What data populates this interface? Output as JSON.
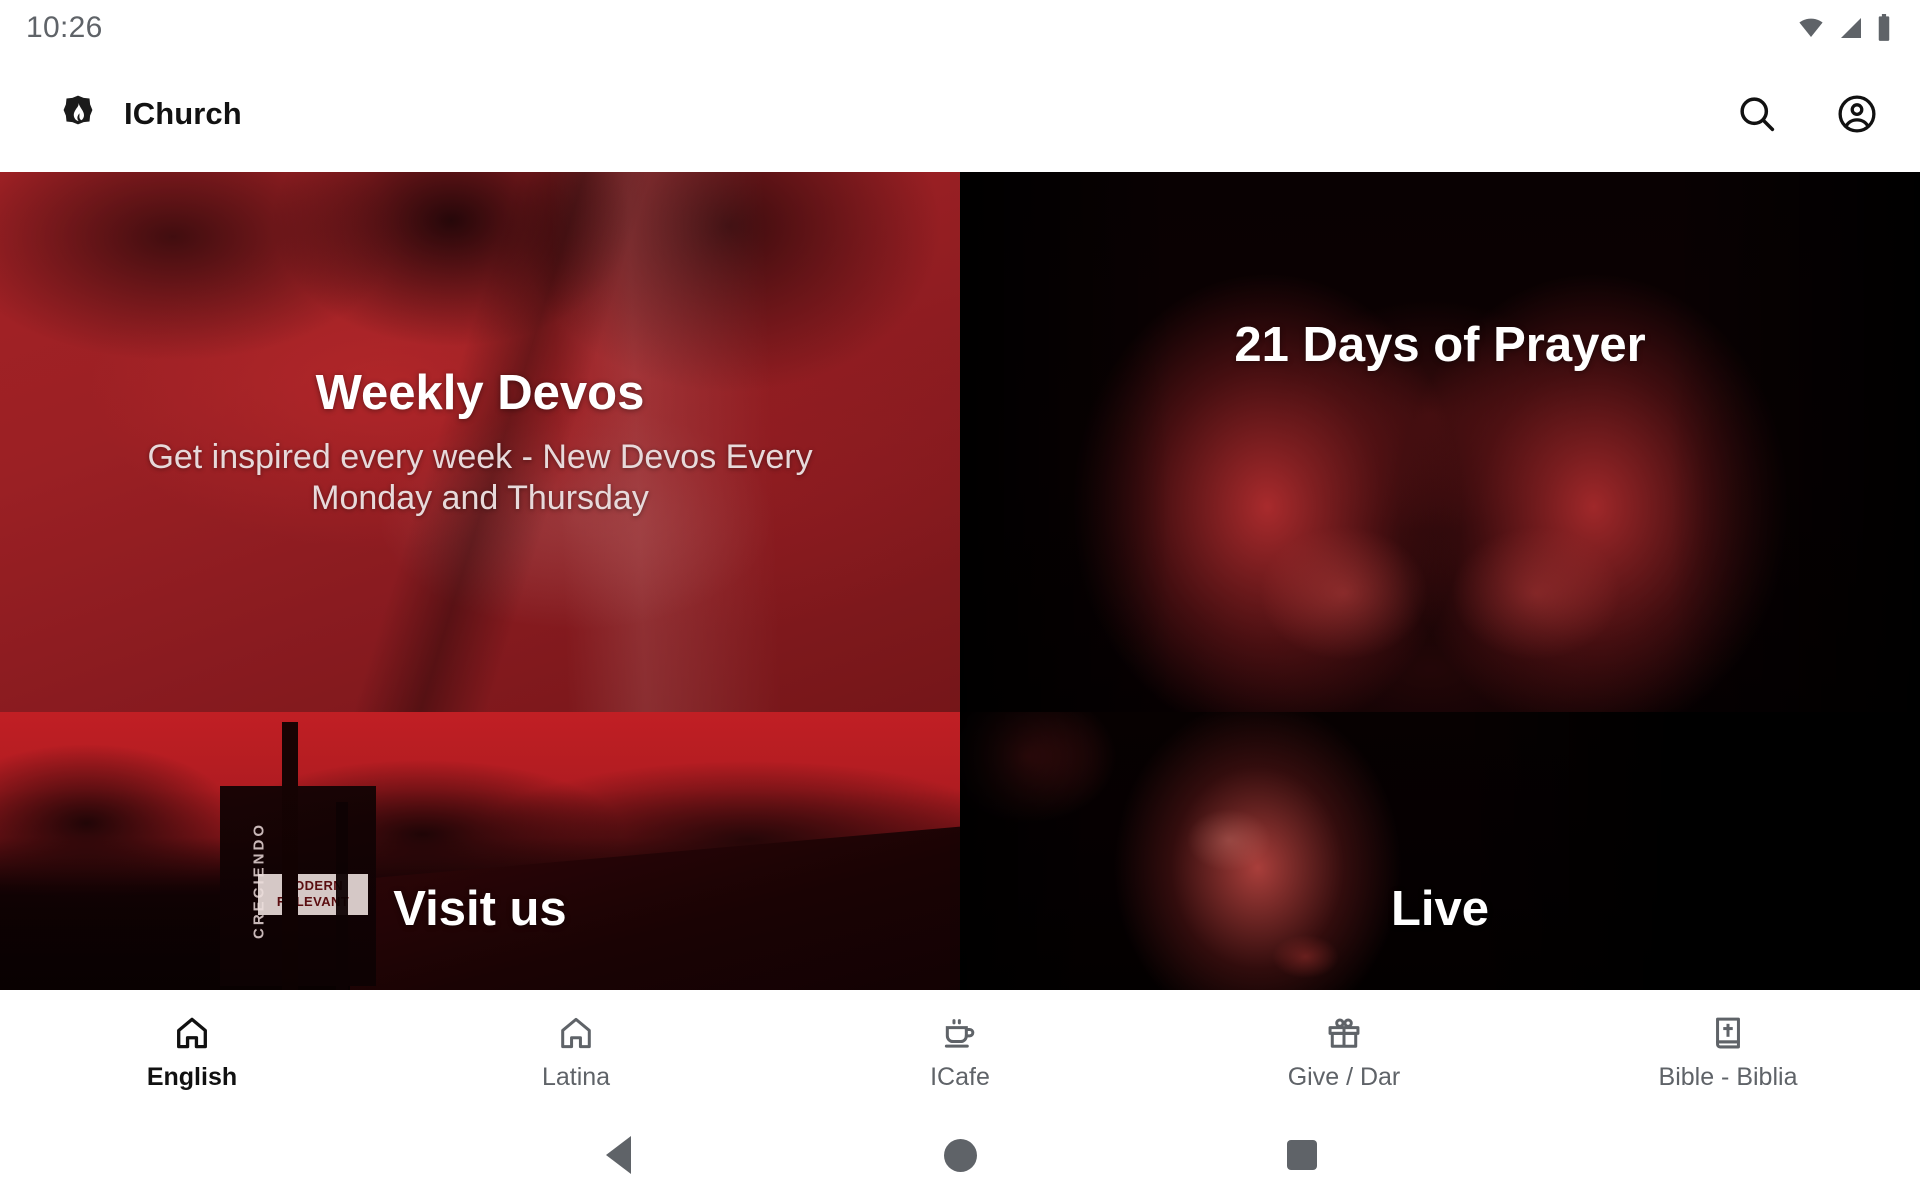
{
  "status_bar": {
    "time": "10:26",
    "icons": [
      "wifi-icon",
      "cellular-signal-icon",
      "battery-icon"
    ]
  },
  "app_bar": {
    "logo_icon": "church-flame-logo-icon",
    "title": "IChurch",
    "actions": [
      {
        "icon": "search-icon",
        "label": "Search"
      },
      {
        "icon": "account-circle-icon",
        "label": "Account"
      }
    ]
  },
  "cards": [
    {
      "id": "weekly-devos",
      "title": "Weekly Devos",
      "subtitle": "Get inspired every week - New Devos Every Monday and Thursday"
    },
    {
      "id": "21-days-of-prayer",
      "title": "21 Days of Prayer",
      "subtitle": ""
    },
    {
      "id": "visit-us",
      "title": "Visit us",
      "subtitle": "",
      "photo_text": {
        "banner_vertical": "CRECIENDO",
        "banner_plate": "MODERN RELEVANT"
      }
    },
    {
      "id": "live",
      "title": "Live",
      "subtitle": ""
    }
  ],
  "bottom_nav": {
    "active_index": 0,
    "items": [
      {
        "label": "English",
        "icon": "home-icon"
      },
      {
        "label": "Latina",
        "icon": "home-icon"
      },
      {
        "label": "ICafe",
        "icon": "coffee-cup-icon"
      },
      {
        "label": "Give / Dar",
        "icon": "gift-icon"
      },
      {
        "label": "Bible - Biblia",
        "icon": "bible-book-icon"
      }
    ]
  },
  "system_nav": {
    "buttons": [
      {
        "name": "back-button",
        "icon": "triangle-back-icon"
      },
      {
        "name": "home-button",
        "icon": "circle-home-icon"
      },
      {
        "name": "recents-button",
        "icon": "square-recents-icon"
      }
    ]
  },
  "colors": {
    "accent_red": "#a52226",
    "card_dark": "#0a0102",
    "nav_inactive": "#5f6368",
    "nav_active": "#111111",
    "surface": "#ffffff"
  }
}
